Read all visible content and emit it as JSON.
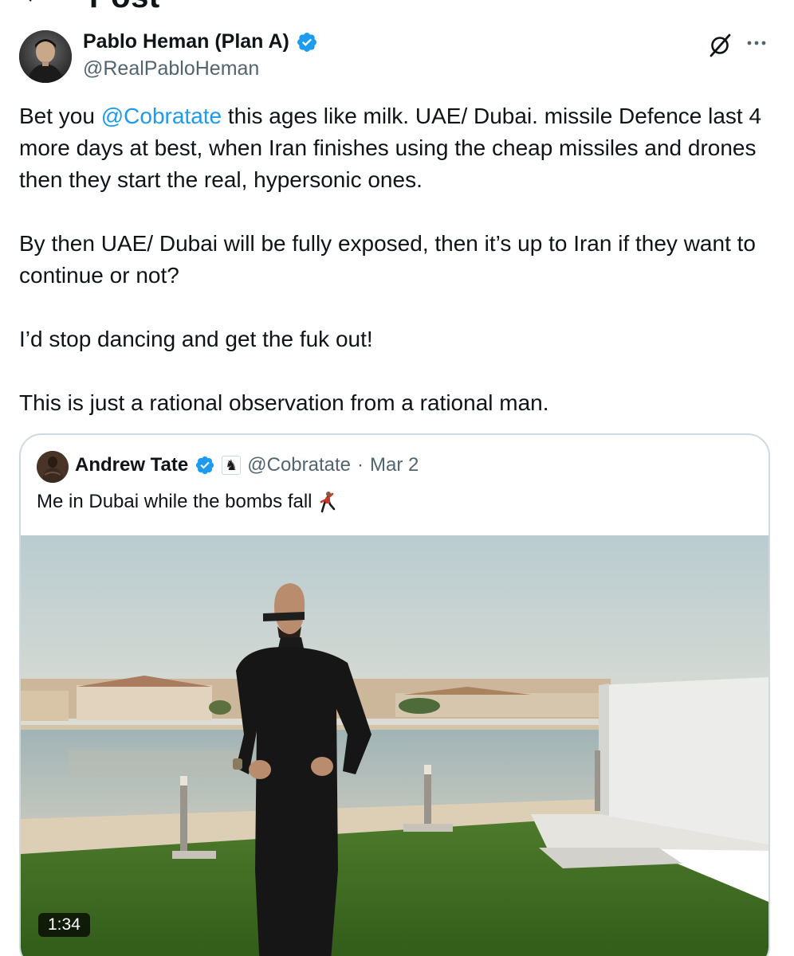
{
  "header": {
    "title": "Post"
  },
  "post": {
    "author_name": "Pablo Heman (Plan A)",
    "author_handle": "@RealPabloHeman",
    "paragraphs": [
      {
        "before": "Bet you ",
        "mention": "@Cobratate",
        "after": " this ages like milk. UAE/ Dubai. missile Defence last 4 more days at best, when Iran finishes using the cheap missiles and drones then they start the real, hypersonic ones."
      },
      {
        "text": "By then UAE/ Dubai will be fully exposed, then it’s up to Iran if they want to continue or not?"
      },
      {
        "text": "I’d stop dancing and get the fuk out!"
      },
      {
        "text": "This is just a rational observation from a rational man."
      }
    ]
  },
  "quoted": {
    "author_name": "Andrew Tate",
    "handle": "@Cobratate",
    "separator": "·",
    "date": "Mar 2",
    "text": "Me in Dubai while the bombs fall",
    "badge_glyph": "♞",
    "media": {
      "type": "video",
      "duration": "1:34"
    }
  },
  "icons": {
    "back": "back-arrow-icon",
    "verified": "verified-badge-icon",
    "grok": "grok-icon",
    "more": "more-options-icon",
    "dance": "man-dancing-emoji-icon"
  },
  "colors": {
    "link": "#1d9bf0",
    "verified": "#1d9bf0",
    "secondary_text": "#536471",
    "text": "#0f1419",
    "border": "#cfd9de"
  }
}
